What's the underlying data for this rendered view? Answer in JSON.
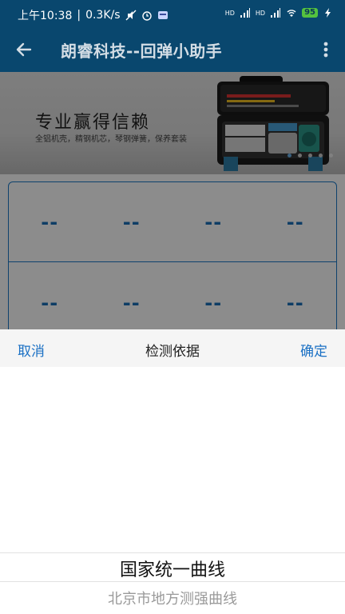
{
  "status_bar": {
    "time": "上午10:38",
    "speed": "0.3K/s",
    "signal1": "HD",
    "signal2": "HD",
    "battery": "95",
    "icons": [
      "mute-icon",
      "alarm-icon",
      "app-icon",
      "signal-icon",
      "wifi-icon",
      "battery-icon",
      "charging-icon"
    ]
  },
  "app_bar": {
    "title": "朗睿科技--回弹小助手",
    "back_icon": "back-arrow-icon",
    "menu_icon": "more-vert-icon"
  },
  "banner": {
    "title": "专业赢得信赖",
    "subtitle": "全铝机壳，精钢机芯，琴钢弹簧，保养套装",
    "page_count": 5,
    "active_page": 0
  },
  "grid": {
    "row1": [
      "--",
      "--",
      "--",
      "--"
    ],
    "row2": [
      "--",
      "--",
      "--",
      "--"
    ]
  },
  "picker": {
    "cancel": "取消",
    "title": "检测依据",
    "confirm": "确定",
    "selected_option": "国家统一曲线",
    "next_option": "北京市地方测强曲线"
  },
  "colors": {
    "primary": "#09476e",
    "accent": "#1a70c4",
    "battery": "#54c23f"
  }
}
